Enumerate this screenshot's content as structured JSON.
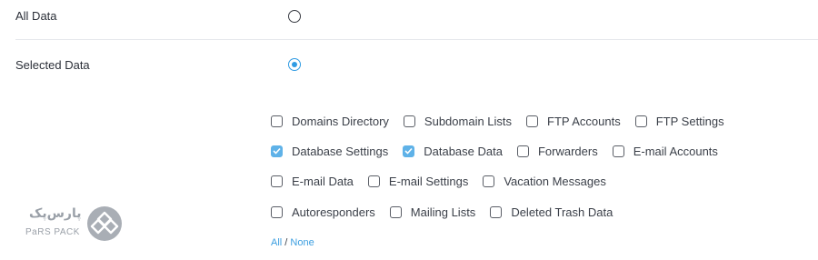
{
  "backup_options": {
    "all_data": {
      "label": "All Data",
      "selected": false
    },
    "selected_data": {
      "label": "Selected Data",
      "selected": true
    }
  },
  "items": {
    "domains_directory": {
      "label": "Domains Directory",
      "checked": false
    },
    "subdomain_lists": {
      "label": "Subdomain Lists",
      "checked": false
    },
    "ftp_accounts": {
      "label": "FTP Accounts",
      "checked": false
    },
    "ftp_settings": {
      "label": "FTP Settings",
      "checked": false
    },
    "database_settings": {
      "label": "Database Settings",
      "checked": true
    },
    "database_data": {
      "label": "Database Data",
      "checked": true
    },
    "forwarders": {
      "label": "Forwarders",
      "checked": false
    },
    "email_accounts": {
      "label": "E-mail Accounts",
      "checked": false
    },
    "email_data": {
      "label": "E-mail Data",
      "checked": false
    },
    "email_settings": {
      "label": "E-mail Settings",
      "checked": false
    },
    "vacation_messages": {
      "label": "Vacation Messages",
      "checked": false
    },
    "autoresponders": {
      "label": "Autoresponders",
      "checked": false
    },
    "mailing_lists": {
      "label": "Mailing Lists",
      "checked": false
    },
    "deleted_trash_data": {
      "label": "Deleted Trash Data",
      "checked": false
    }
  },
  "select_links": {
    "all": "All",
    "separator": "/",
    "none": "None"
  },
  "watermark": {
    "text_fa": "پارس‌پک",
    "text_en": "PaRS PACK"
  },
  "colors": {
    "accent": "#2f9be3",
    "checkbox_checked": "#5fb2e8",
    "link": "#3b9ee0"
  }
}
